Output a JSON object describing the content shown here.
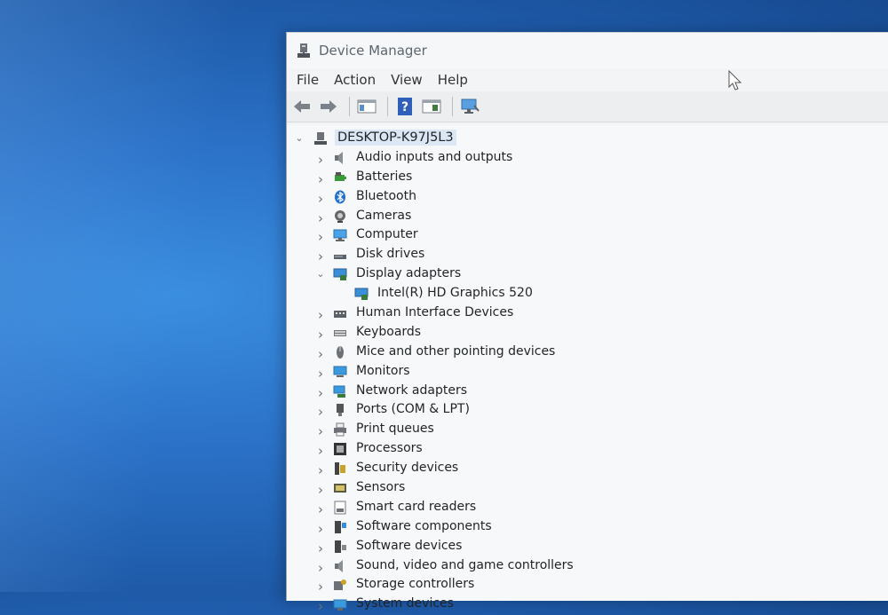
{
  "window": {
    "title": "Device Manager"
  },
  "menu": [
    "File",
    "Action",
    "View",
    "Help"
  ],
  "toolbar": {
    "buttons": [
      "back-icon",
      "forward-icon",
      "properties-icon",
      "help-icon",
      "show-hide-icon",
      "scan-hardware-icon"
    ]
  },
  "tree": {
    "root": "DESKTOP-K97J5L3",
    "categories": [
      {
        "label": "Audio inputs and outputs",
        "icon": "speaker-icon",
        "expanded": false
      },
      {
        "label": "Batteries",
        "icon": "battery-icon",
        "expanded": false
      },
      {
        "label": "Bluetooth",
        "icon": "bluetooth-icon",
        "expanded": false
      },
      {
        "label": "Cameras",
        "icon": "camera-icon",
        "expanded": false
      },
      {
        "label": "Computer",
        "icon": "computer-icon",
        "expanded": false
      },
      {
        "label": "Disk drives",
        "icon": "disk-drive-icon",
        "expanded": false
      },
      {
        "label": "Display adapters",
        "icon": "display-adapter-icon",
        "expanded": true
      },
      {
        "label": "Intel(R) HD Graphics 520",
        "icon": "display-adapter-icon",
        "child": true
      },
      {
        "label": "Human Interface Devices",
        "icon": "hid-icon",
        "expanded": false
      },
      {
        "label": "Keyboards",
        "icon": "keyboard-icon",
        "expanded": false
      },
      {
        "label": "Mice and other pointing devices",
        "icon": "mouse-icon",
        "expanded": false
      },
      {
        "label": "Monitors",
        "icon": "monitor-icon",
        "expanded": false
      },
      {
        "label": "Network adapters",
        "icon": "network-adapter-icon",
        "expanded": false
      },
      {
        "label": "Ports (COM & LPT)",
        "icon": "port-icon",
        "expanded": false
      },
      {
        "label": "Print queues",
        "icon": "printer-icon",
        "expanded": false
      },
      {
        "label": "Processors",
        "icon": "processor-icon",
        "expanded": false
      },
      {
        "label": "Security devices",
        "icon": "security-device-icon",
        "expanded": false
      },
      {
        "label": "Sensors",
        "icon": "sensor-icon",
        "expanded": false
      },
      {
        "label": "Smart card readers",
        "icon": "smart-card-icon",
        "expanded": false
      },
      {
        "label": "Software components",
        "icon": "software-component-icon",
        "expanded": false
      },
      {
        "label": "Software devices",
        "icon": "software-device-icon",
        "expanded": false
      },
      {
        "label": "Sound, video and game controllers",
        "icon": "speaker-icon",
        "expanded": false
      },
      {
        "label": "Storage controllers",
        "icon": "storage-controller-icon",
        "expanded": false
      },
      {
        "label": "System devices",
        "icon": "system-device-icon",
        "expanded": false
      }
    ]
  },
  "colors": {
    "desktop": "#2b72c8",
    "window_bg": "#f3f4f5",
    "selection": "#dbe7f4"
  }
}
